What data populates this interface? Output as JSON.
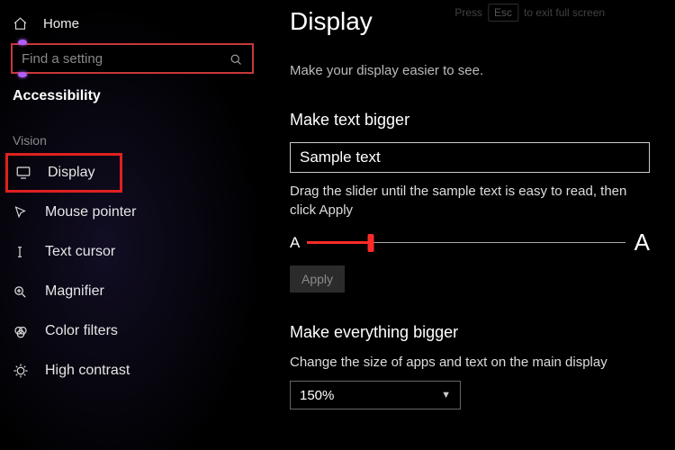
{
  "sidebar": {
    "home_label": "Home",
    "search_placeholder": "Find a setting",
    "category": "Accessibility",
    "group": "Vision",
    "items": [
      {
        "label": "Display"
      },
      {
        "label": "Mouse pointer"
      },
      {
        "label": "Text cursor"
      },
      {
        "label": "Magnifier"
      },
      {
        "label": "Color filters"
      },
      {
        "label": "High contrast"
      }
    ]
  },
  "hint": {
    "press": "Press",
    "key": "Esc",
    "rest": "to exit full screen"
  },
  "main": {
    "title": "Display",
    "subtitle": "Make your display easier to see.",
    "text_section": "Make text bigger",
    "sample_text": "Sample text",
    "slider_instruction": "Drag the slider until the sample text is easy to read, then click Apply",
    "small_a": "A",
    "big_a": "A",
    "apply": "Apply",
    "everything_section": "Make everything bigger",
    "size_desc": "Change the size of apps and text on the main display",
    "scale_value": "150%"
  }
}
